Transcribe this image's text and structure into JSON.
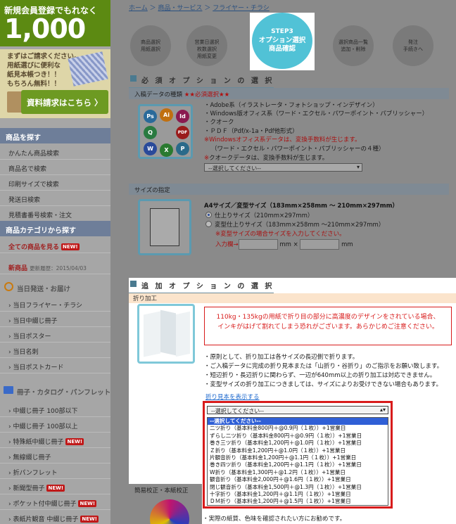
{
  "sidebar": {
    "promo_top": "新規会員登録でもれなく",
    "promo_amount": "1,000",
    "sample_promo": "まずはご請求ください。\n用紙選びに便利な\n紙見本帳つき！！\nもちろん無料！！",
    "request_button": "資料請求はこちら 〉",
    "find_products_heading": "商品を探す",
    "find_items": [
      "かんたん商品検索",
      "商品名で検索",
      "印刷サイズで検索",
      "発送日検索",
      "見積書番号検索・注文"
    ],
    "category_heading": "商品カテゴリから探す",
    "all_products": "全ての商品を見る",
    "new_badge": "NEW!",
    "new_products": "新商品",
    "update_history": "更新履歴：2015/04/03",
    "sameday_heading": "当日発送・お届け",
    "sameday_items": [
      "当日フライヤー・チラシ",
      "当日中綴じ冊子",
      "当日ポスター",
      "当日名刺",
      "当日ポストカード"
    ],
    "booklet_heading": "冊子・カタログ・パンフレット",
    "booklet_items": [
      {
        "label": "中綴じ冊子 100部以下",
        "new": ""
      },
      {
        "label": "中綴じ冊子 100部以上",
        "new": ""
      },
      {
        "label": "特殊紙中綴じ冊子",
        "new": "NEW!"
      },
      {
        "label": "無線綴じ冊子",
        "new": ""
      },
      {
        "label": "折パンフレット",
        "new": ""
      },
      {
        "label": "新聞型冊子",
        "new": "NEW!"
      },
      {
        "label": "ポケット付中綴じ冊子",
        "new": "NEW!"
      },
      {
        "label": "表紙片観音 中綴じ冊子",
        "new": "NEW!"
      }
    ]
  },
  "breadcrumb": [
    "ホーム",
    "商品・サービス",
    "フライヤー・チラシ"
  ],
  "steps": [
    {
      "label": "商品選択\n用紙選択"
    },
    {
      "label": "営業日選択\n枚数選択\n用紙変更"
    },
    {
      "label": "STEP3",
      "sub": "オプション選択\n商品確認"
    },
    {
      "label": "選択商品一覧\n追加・削除"
    },
    {
      "label": "発注\n手続きへ"
    }
  ],
  "required_section": {
    "title": "必 須 オ プ シ ョ ン の 選 択",
    "data_type_label": "入稿データの種類",
    "required_mark": "★★必須選択★★",
    "app_icons": [
      "Ps",
      "Ai",
      "Id",
      "Q",
      "PDF",
      "W",
      "X",
      "P"
    ],
    "lines": [
      "・Adobe系（イラストレータ・フォトショップ・インデザイン）",
      "・Windows版オフィス系（ワード・エクセル・パワーポイント・パブリッシャー）",
      "・クオーク",
      "・ＰＤＦ（Pdf/x-1a・Pdf他形式）"
    ],
    "note1": "※Windowsオフィス系データは、変換手数料が生じます。",
    "note1b": "（ワード・エクセル・パワーポイント・パブリッシャーの４種）",
    "note2_mark": "※",
    "note2": "クオークデータは、変換手数料が生じます。",
    "select_placeholder": "--選択してください--",
    "size_label": "サイズの指定",
    "size_title": "A4サイズ／変型サイズ（183mm×258mm 〜 210mm×297mm）",
    "size_option1": "仕上りサイズ（210mm×297mm）",
    "size_option2": "変型仕上りサイズ（183mm×258mm 〜210mm×297mm）",
    "size_note": "※変型サイズの場合サイズを入力してください。",
    "input_label": "入力欄→",
    "unit1": "mm ×",
    "unit2": "mm"
  },
  "additional_section": {
    "title": "追 加 オ プ シ ョ ン の 選 択",
    "fold_label": "折り加工",
    "warning_line1": "110kg・135kgの用紙で折り目の部分に高濃度のデザインをされている場合、",
    "warning_line2": "インキがはげて割れてしまう恐れがございます。あらかじめご注意ください。",
    "info_lines": [
      "・原則として、折り加工は各サイズの長辺側で折ります。",
      "・ご入稿データに完成の折り見本または「山折り・谷折り」のご指示をお願い致します。",
      "・短辺折り・長辺折りに関わらず、一辺が640mm以上の折り加工は対応できません。",
      "・変型サイズの折り加工につきましては、サイズによりお受けできない場合もあります。"
    ],
    "sample_link": "折り見本を表示する",
    "dropdown_value": "--選択してください--",
    "dropdown_options": [
      "--選択してください--",
      "二ツ折り（基本料金800円＋@0.9円（１枚））+1営業日",
      "ずらし二ツ折り（基本料金800円＋@0.9円（１枚））+1営業日",
      "巻き三ツ折り（基本料金1,200円＋@1.0円（１枚））+1営業日",
      "Ｚ折り（基本料金1,200円＋@1.0円（１枚））+1営業日",
      "片観音折り（基本料金1,200円＋@1.1円（１枚））+1営業日",
      "巻き四ツ折り（基本料金1,200円＋@1.1円（１枚））+1営業日",
      "W折り（基本料金1,300円＋@1.2円（１枚））+1営業日",
      "観音折り（基本料金2,000円＋@1.6円（１枚））+1営業日",
      "閉じ観音折り（基本料金1,500円＋@1.3円（１枚））+1営業日",
      "十字折り（基本料金1,200円＋@1.1円（１枚））+1営業日",
      "ＤＭ折り（基本料金1,200円＋@1.5円（１枚））+1営業日"
    ],
    "proof_label": "簡易校正・本紙校正",
    "bottom_note": "・実際の紙質、色味を確認されたい方にお勧めです。"
  }
}
